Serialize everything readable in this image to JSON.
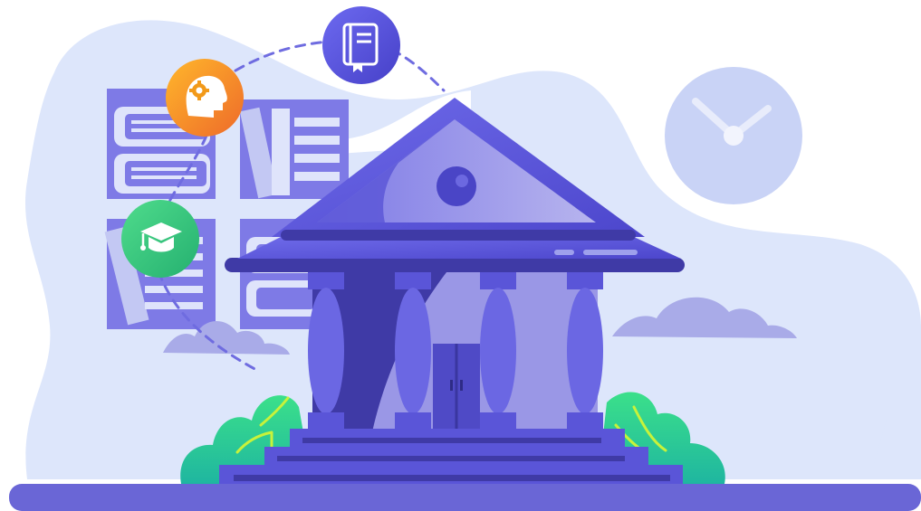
{
  "scene": {
    "subject": "education-building-illustration",
    "icons": [
      "book-icon",
      "brain-gear-icon",
      "graduation-cap-icon",
      "clock-icon"
    ],
    "colors": {
      "background_blob": "#dde6fb",
      "building_primary": "#5a55d8",
      "building_dark": "#3f3aa6",
      "building_light": "#9a97e6",
      "ground": "#6a66d6",
      "shelf": "#7e7ae6",
      "bush": "#2fcf86",
      "book_badge": "#5b56e0",
      "brain_badge": "#f29a1a",
      "cap_badge": "#3fc97c",
      "clock_face": "#c9d3f6"
    }
  }
}
